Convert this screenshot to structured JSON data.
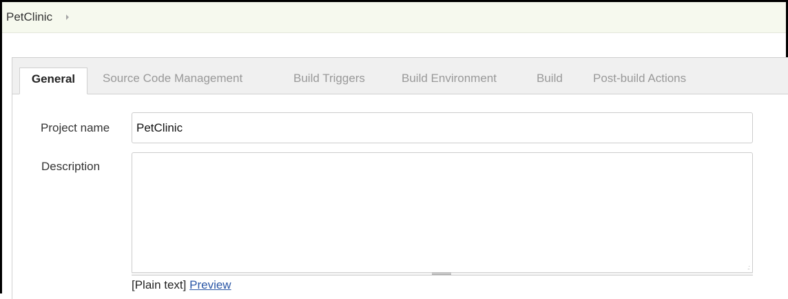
{
  "breadcrumb": {
    "items": [
      "PetClinic"
    ]
  },
  "tabs": [
    {
      "label": "General",
      "active": true
    },
    {
      "label": "Source Code Management",
      "active": false
    },
    {
      "label": "Build Triggers",
      "active": false
    },
    {
      "label": "Build Environment",
      "active": false
    },
    {
      "label": "Build",
      "active": false
    },
    {
      "label": "Post-build Actions",
      "active": false
    }
  ],
  "form": {
    "project_name_label": "Project name",
    "project_name_value": "PetClinic",
    "description_label": "Description",
    "description_value": "",
    "format_text": "[Plain text]",
    "preview_link": "Preview"
  },
  "colors": {
    "breadcrumb_bg": "#f6f9ee",
    "tabbar_bg": "#f0f0f0",
    "inactive_tab_text": "#999999",
    "link": "#2a56a6"
  }
}
